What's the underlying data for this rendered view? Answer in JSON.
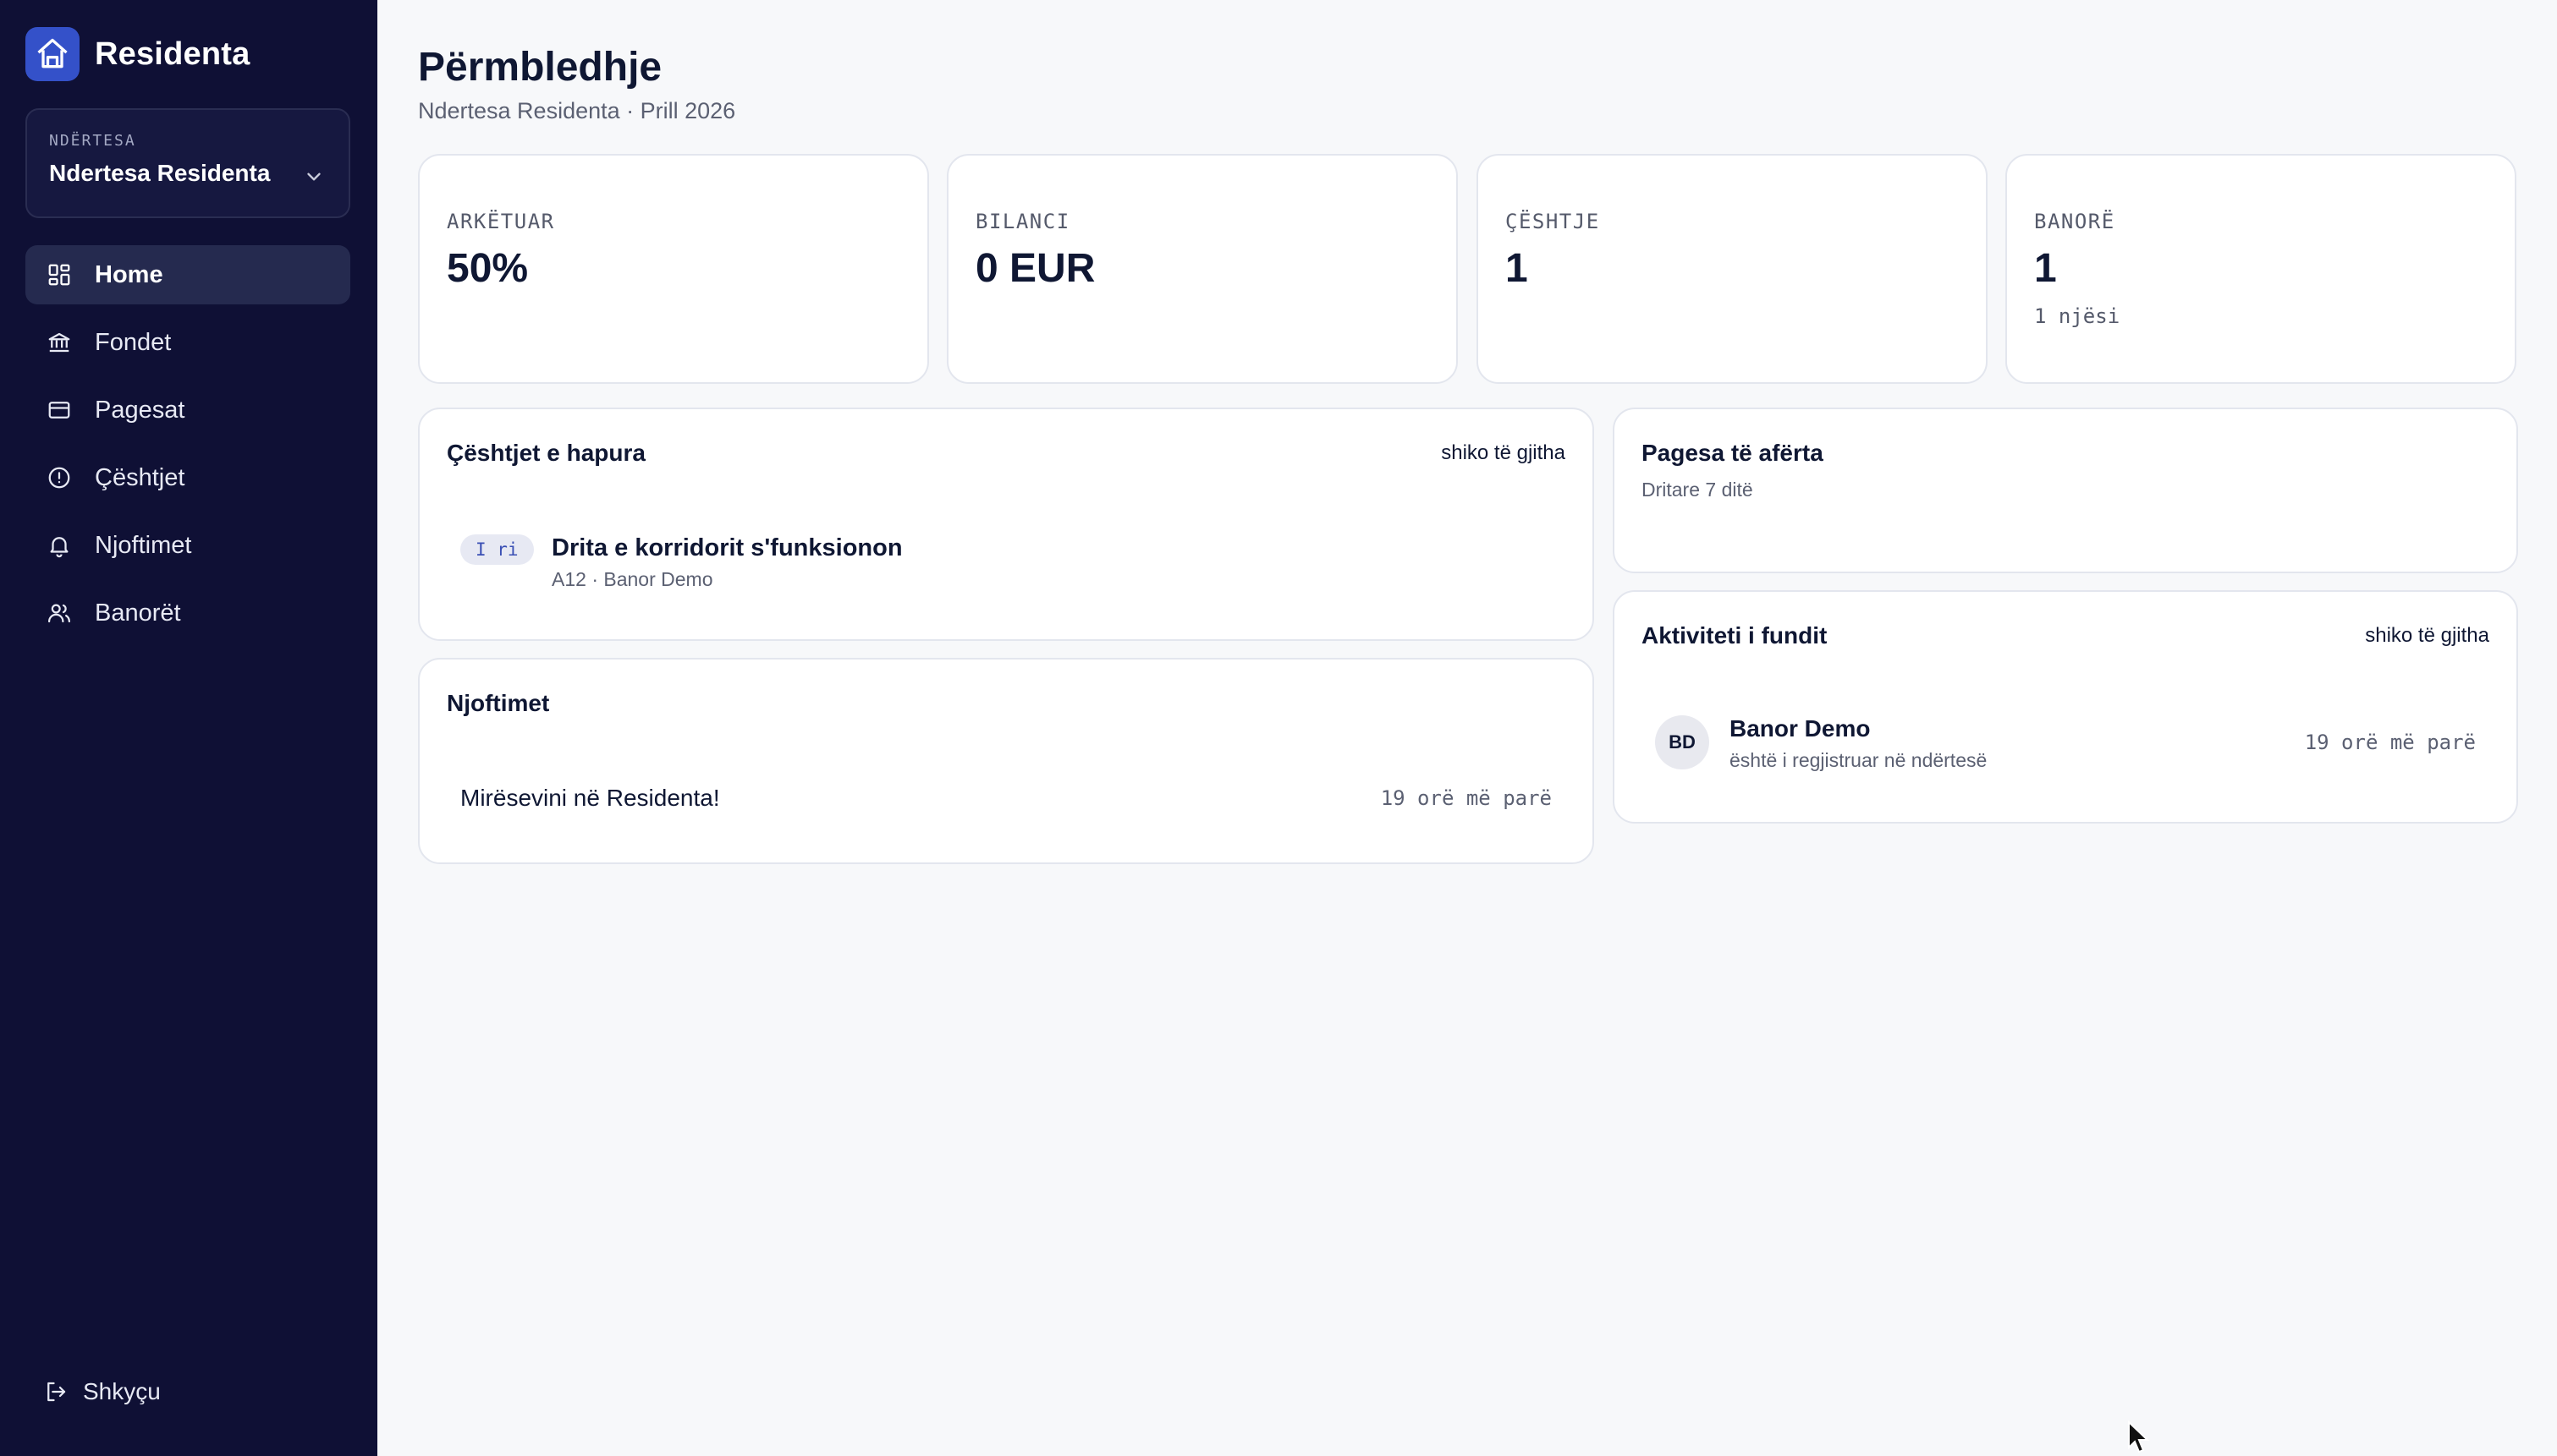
{
  "app": {
    "name": "Residenta"
  },
  "building_select": {
    "label": "NDËRTESA",
    "value": "Ndertesa Residenta"
  },
  "nav": {
    "items": [
      {
        "label": "Home",
        "icon": "grid-icon",
        "active": true
      },
      {
        "label": "Fondet",
        "icon": "bank-icon",
        "active": false
      },
      {
        "label": "Pagesat",
        "icon": "card-icon",
        "active": false
      },
      {
        "label": "Çështjet",
        "icon": "alert-circle-icon",
        "active": false
      },
      {
        "label": "Njoftimet",
        "icon": "bell-icon",
        "active": false
      },
      {
        "label": "Banorët",
        "icon": "users-icon",
        "active": false
      }
    ],
    "logout_label": "Shkyçu"
  },
  "header": {
    "title": "Përmbledhje",
    "subtitle": "Ndertesa Residenta · Prill 2026"
  },
  "stats": [
    {
      "label": "ARKËTUAR",
      "value": "50%"
    },
    {
      "label": "BILANCI",
      "value": "0 EUR"
    },
    {
      "label": "ÇËSHTJE",
      "value": "1"
    },
    {
      "label": "BANORË",
      "value": "1",
      "sub": "1 njësi"
    }
  ],
  "open_issues": {
    "title": "Çështjet e hapura",
    "link": "shiko të gjitha",
    "items": [
      {
        "badge": "I ri",
        "title": "Drita e korridorit s'funksionon",
        "meta": "A12 · Banor Demo"
      }
    ]
  },
  "notices": {
    "title": "Njoftimet",
    "items": [
      {
        "text": "Mirësevini në Residenta!",
        "time": "19 orë më parë"
      }
    ]
  },
  "upcoming_payments": {
    "title": "Pagesa të afërta",
    "subtitle": "Dritare 7 ditë"
  },
  "recent_activity": {
    "title": "Aktiviteti i fundit",
    "link": "shiko të gjitha",
    "items": [
      {
        "initials": "BD",
        "name": "Banor Demo",
        "desc": "është i regjistruar në ndërtesë",
        "time": "19 orë më parë"
      }
    ]
  },
  "colors": {
    "sidebar_bg": "#0f1035",
    "accent": "#3451c9",
    "page_bg": "#f7f8fa"
  }
}
